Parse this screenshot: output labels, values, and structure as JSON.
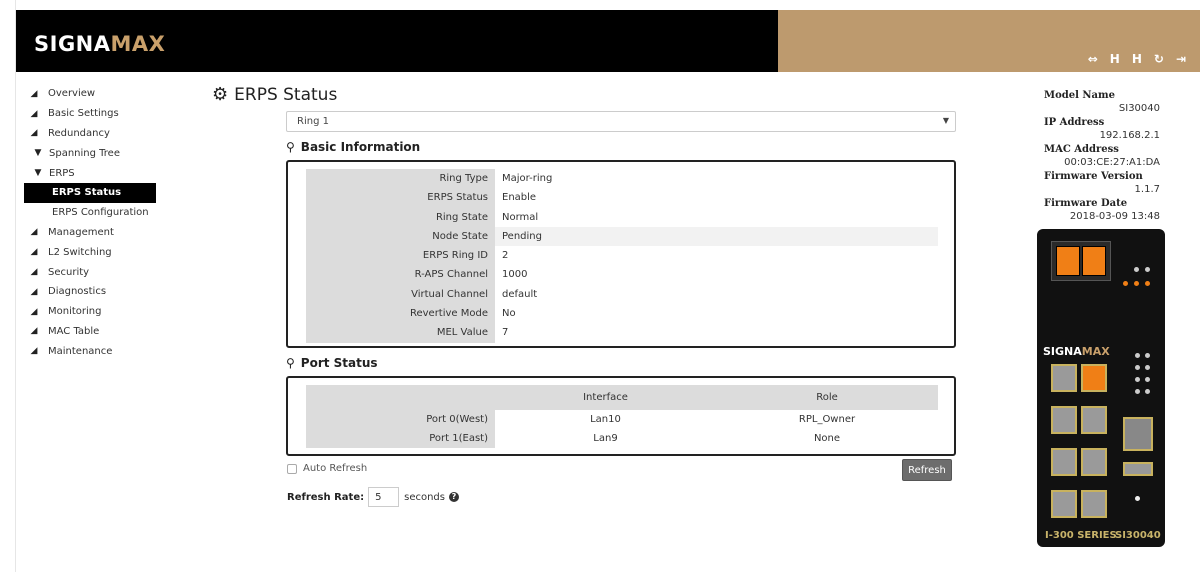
{
  "brand": {
    "logo_main": "SIGNA",
    "logo_accent": "MAX"
  },
  "toolbar": [
    {
      "name": "link-icon",
      "glyph": "⇔"
    },
    {
      "name": "save-icon",
      "glyph": "H"
    },
    {
      "name": "save-all-icon",
      "glyph": "H"
    },
    {
      "name": "refresh-icon",
      "glyph": "↻"
    },
    {
      "name": "logout-icon",
      "glyph": "⇥"
    }
  ],
  "sidebar": {
    "items": [
      {
        "label": "Overview"
      },
      {
        "label": "Basic Settings"
      },
      {
        "label": "Redundancy"
      },
      {
        "label": "Spanning Tree"
      },
      {
        "label": "ERPS"
      },
      {
        "label": "ERPS Status"
      },
      {
        "label": "ERPS Configuration"
      },
      {
        "label": "Management"
      },
      {
        "label": "L2 Switching"
      },
      {
        "label": "Security"
      },
      {
        "label": "Diagnostics"
      },
      {
        "label": "Monitoring"
      },
      {
        "label": "MAC Table"
      },
      {
        "label": "Maintenance"
      }
    ]
  },
  "page": {
    "title": "ERPS Status"
  },
  "ring_select": {
    "value": "Ring 1"
  },
  "basic_info": {
    "heading": "Basic Information",
    "rows": [
      {
        "label": "Ring Type",
        "value": "Major-ring"
      },
      {
        "label": "ERPS Status",
        "value": "Enable"
      },
      {
        "label": "Ring State",
        "value": "Normal"
      },
      {
        "label": "Node State",
        "value": "Pending"
      },
      {
        "label": "ERPS Ring ID",
        "value": "2"
      },
      {
        "label": "R-APS Channel",
        "value": "1000"
      },
      {
        "label": "Virtual Channel",
        "value": "default"
      },
      {
        "label": "Revertive Mode",
        "value": "No"
      },
      {
        "label": "MEL Value",
        "value": "7"
      }
    ]
  },
  "port_status": {
    "heading": "Port Status",
    "columns": [
      "",
      "Interface",
      "Role"
    ],
    "rows": [
      {
        "port": "Port 0(West)",
        "interface": "Lan10",
        "role": "RPL_Owner"
      },
      {
        "port": "Port 1(East)",
        "interface": "Lan9",
        "role": "None"
      }
    ]
  },
  "controls": {
    "auto_refresh_label": "Auto Refresh",
    "refresh_button": "Refresh",
    "refresh_rate_label": "Refresh Rate:",
    "refresh_rate_value": "5",
    "seconds_label": "seconds"
  },
  "device_info": {
    "model_name_label": "Model Name",
    "model_name": "SI30040",
    "ip_label": "IP Address",
    "ip": "192.168.2.1",
    "mac_label": "MAC Address",
    "mac": "00:03:CE:27:A1:DA",
    "fw_version_label": "Firmware Version",
    "fw_version": "1.1.7",
    "fw_date_label": "Firmware Date",
    "fw_date": "2018-03-09 13:48"
  },
  "device_image": {
    "brand_main": "SIGNA",
    "brand_accent": "MAX",
    "series": "I-300 SERIES",
    "model": "SI30040"
  },
  "colors": {
    "header_black": "#000000",
    "header_tan": "#bd9a6e",
    "port_orange": "#f07f16",
    "active_bg": "#000000"
  }
}
